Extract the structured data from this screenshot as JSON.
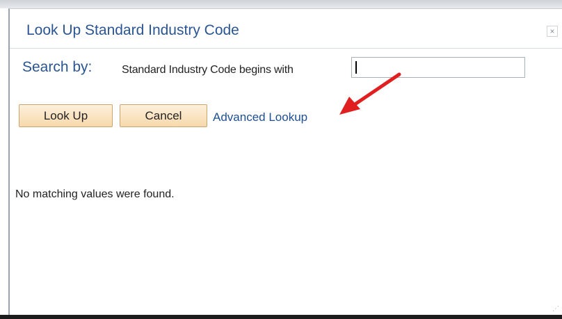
{
  "dialog": {
    "title": "Look Up Standard Industry Code",
    "close_icon": "close-icon",
    "close_glyph": "×"
  },
  "search": {
    "label": "Search by:",
    "field_label": "Standard Industry Code begins with",
    "value": "",
    "placeholder": ""
  },
  "actions": {
    "lookup_label": "Look Up",
    "cancel_label": "Cancel",
    "advanced_label": "Advanced Lookup"
  },
  "results": {
    "message": "No matching values were found."
  },
  "annotation": {
    "icon": "red-arrow-icon",
    "color": "#e02020"
  },
  "colors": {
    "title": "#2a5592",
    "link": "#1e4f91",
    "button_top": "#fdf0dc",
    "button_bottom": "#f7d9ac"
  }
}
